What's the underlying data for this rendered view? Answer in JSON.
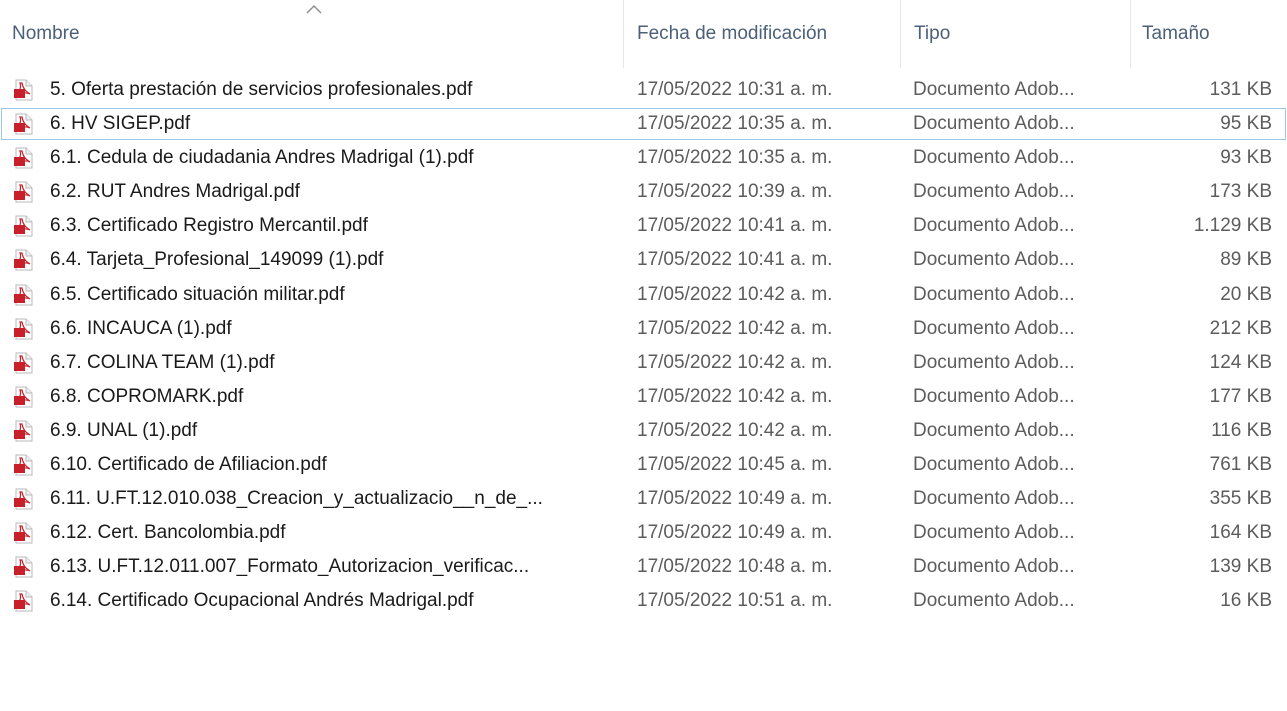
{
  "columns": {
    "name": "Nombre",
    "date": "Fecha de modificación",
    "type": "Tipo",
    "size": "Tamaño"
  },
  "sort": {
    "column": "name",
    "direction": "ascending"
  },
  "icon": "pdf-file-icon",
  "selected_index": 1,
  "files": [
    {
      "name": "5. Oferta prestación de servicios profesionales.pdf",
      "date": "17/05/2022 10:31 a. m.",
      "type": "Documento Adob...",
      "size": "131 KB"
    },
    {
      "name": "6. HV SIGEP.pdf",
      "date": "17/05/2022 10:35 a. m.",
      "type": "Documento Adob...",
      "size": "95 KB"
    },
    {
      "name": "6.1. Cedula de ciudadania Andres Madrigal (1).pdf",
      "date": "17/05/2022 10:35 a. m.",
      "type": "Documento Adob...",
      "size": "93 KB"
    },
    {
      "name": "6.2. RUT Andres Madrigal.pdf",
      "date": "17/05/2022 10:39 a. m.",
      "type": "Documento Adob...",
      "size": "173 KB"
    },
    {
      "name": "6.3. Certificado Registro Mercantil.pdf",
      "date": "17/05/2022 10:41 a. m.",
      "type": "Documento Adob...",
      "size": "1.129 KB"
    },
    {
      "name": "6.4. Tarjeta_Profesional_149099 (1).pdf",
      "date": "17/05/2022 10:41 a. m.",
      "type": "Documento Adob...",
      "size": "89 KB"
    },
    {
      "name": "6.5. Certificado situación militar.pdf",
      "date": "17/05/2022 10:42 a. m.",
      "type": "Documento Adob...",
      "size": "20 KB"
    },
    {
      "name": "6.6. INCAUCA (1).pdf",
      "date": "17/05/2022 10:42 a. m.",
      "type": "Documento Adob...",
      "size": "212 KB"
    },
    {
      "name": "6.7. COLINA TEAM (1).pdf",
      "date": "17/05/2022 10:42 a. m.",
      "type": "Documento Adob...",
      "size": "124 KB"
    },
    {
      "name": "6.8. COPROMARK.pdf",
      "date": "17/05/2022 10:42 a. m.",
      "type": "Documento Adob...",
      "size": "177 KB"
    },
    {
      "name": "6.9. UNAL (1).pdf",
      "date": "17/05/2022 10:42 a. m.",
      "type": "Documento Adob...",
      "size": "116 KB"
    },
    {
      "name": "6.10. Certificado de Afiliacion.pdf",
      "date": "17/05/2022 10:45 a. m.",
      "type": "Documento Adob...",
      "size": "761 KB"
    },
    {
      "name": "6.11. U.FT.12.010.038_Creacion_y_actualizacio__n_de_...",
      "date": "17/05/2022 10:49 a. m.",
      "type": "Documento Adob...",
      "size": "355 KB"
    },
    {
      "name": "6.12. Cert. Bancolombia.pdf",
      "date": "17/05/2022 10:49 a. m.",
      "type": "Documento Adob...",
      "size": "164 KB"
    },
    {
      "name": "6.13. U.FT.12.011.007_Formato_Autorizacion_verificac...",
      "date": "17/05/2022 10:48 a. m.",
      "type": "Documento Adob...",
      "size": "139 KB"
    },
    {
      "name": "6.14. Certificado Ocupacional Andrés Madrigal.pdf",
      "date": "17/05/2022 10:51 a. m.",
      "type": "Documento Adob...",
      "size": "16 KB"
    }
  ]
}
